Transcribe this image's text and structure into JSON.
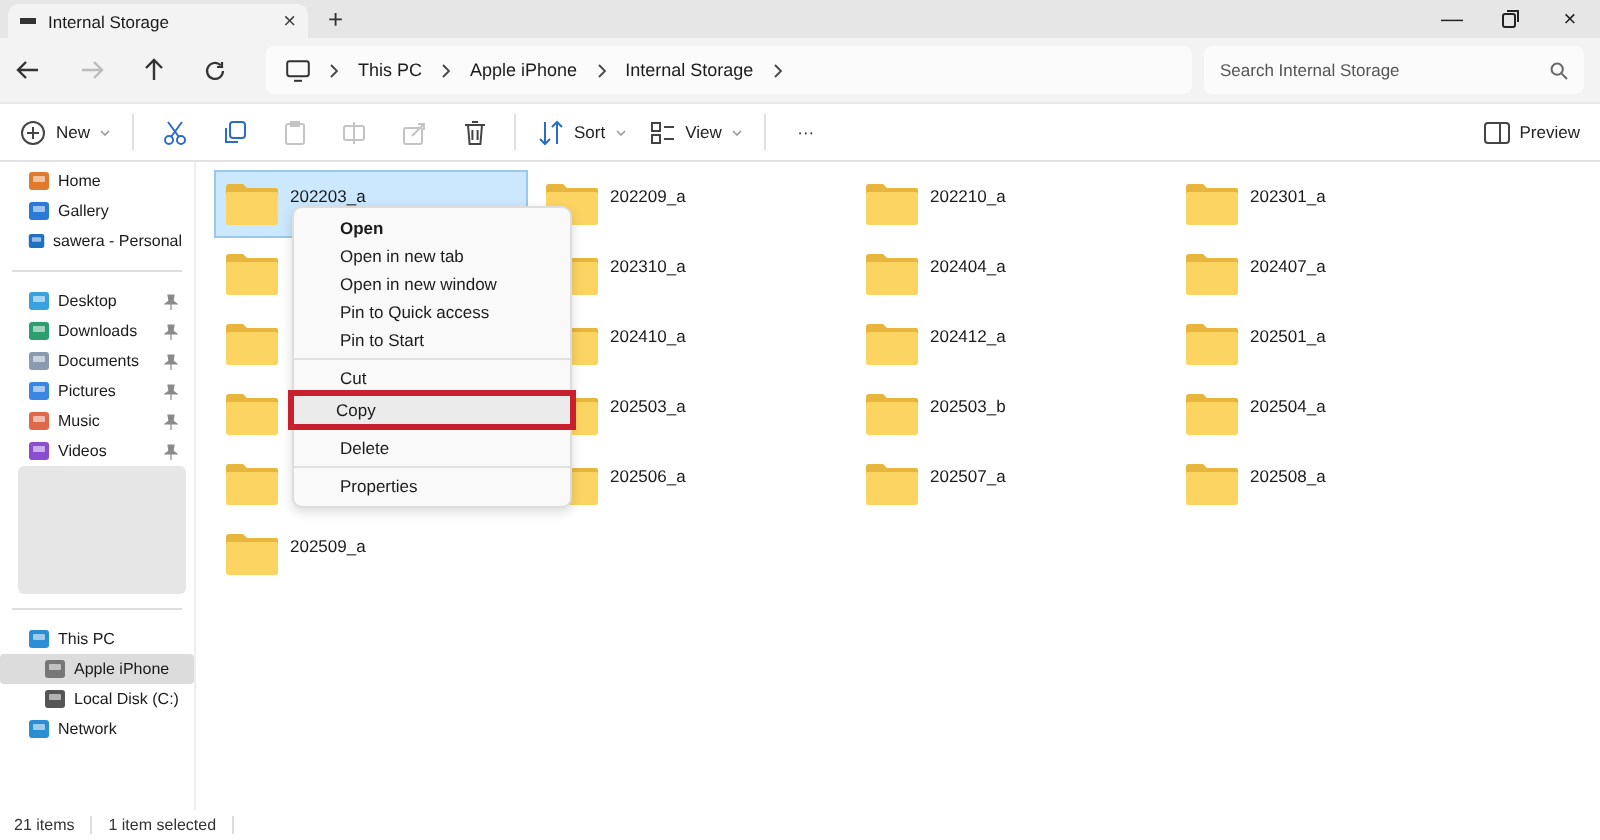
{
  "tab": {
    "title": "Internal Storage",
    "close": "×",
    "new": "+"
  },
  "window_controls": {
    "minimize": "—",
    "close": "×"
  },
  "breadcrumbs": [
    "This PC",
    "Apple iPhone",
    "Internal Storage"
  ],
  "search": {
    "placeholder": "Search Internal Storage"
  },
  "toolbar": [
    {
      "kind": "new",
      "label": "New",
      "disabled": false
    },
    {
      "kind": "cut",
      "disabled": false
    },
    {
      "kind": "copy",
      "disabled": false
    },
    {
      "kind": "paste",
      "disabled": true
    },
    {
      "kind": "rename",
      "disabled": true
    },
    {
      "kind": "share",
      "disabled": true
    },
    {
      "kind": "delete",
      "disabled": false
    },
    {
      "kind": "sort",
      "label": "Sort",
      "disabled": false
    },
    {
      "kind": "view",
      "label": "View",
      "disabled": false
    },
    {
      "kind": "more",
      "label": "···",
      "disabled": false
    }
  ],
  "preview": {
    "label": "Preview"
  },
  "sidebar": {
    "groups": [
      [
        {
          "label": "Home",
          "pinned": false,
          "selected": false
        },
        {
          "label": "Gallery",
          "pinned": false,
          "selected": false
        },
        {
          "label": "sawera - Personal",
          "pinned": false,
          "selected": false
        }
      ],
      [
        {
          "label": "Desktop",
          "pinned": true,
          "selected": false
        },
        {
          "label": "Downloads",
          "pinned": true,
          "selected": false
        },
        {
          "label": "Documents",
          "pinned": true,
          "selected": false
        },
        {
          "label": "Pictures",
          "pinned": true,
          "selected": false
        },
        {
          "label": "Music",
          "pinned": true,
          "selected": false
        },
        {
          "label": "Videos",
          "pinned": true,
          "selected": false
        }
      ],
      [
        {
          "label": "This PC",
          "pinned": false,
          "selected": false,
          "children": [
            {
              "label": "Apple iPhone",
              "pinned": false,
              "selected": true
            },
            {
              "label": "Local Disk (C:)",
              "pinned": false,
              "selected": false
            }
          ]
        },
        {
          "label": "Network",
          "pinned": false,
          "selected": false
        }
      ]
    ]
  },
  "folders": [
    {
      "name": "202203_a",
      "selected": true
    },
    {
      "name": "202209_a",
      "selected": false
    },
    {
      "name": "202210_a",
      "selected": false
    },
    {
      "name": "202301_a",
      "selected": false
    },
    {
      "selected": false
    },
    {
      "name": "202310_a",
      "selected": false
    },
    {
      "name": "202404_a",
      "selected": false
    },
    {
      "name": "202407_a",
      "selected": false
    },
    {
      "selected": false
    },
    {
      "name": "202410_a",
      "selected": false
    },
    {
      "name": "202412_a",
      "selected": false
    },
    {
      "name": "202501_a",
      "selected": false
    },
    {
      "selected": false
    },
    {
      "name": "202503_a",
      "selected": false
    },
    {
      "name": "202503_b",
      "selected": false
    },
    {
      "name": "202504_a",
      "selected": false
    },
    {
      "selected": false
    },
    {
      "name": "202506_a",
      "selected": false
    },
    {
      "name": "202507_a",
      "selected": false
    },
    {
      "name": "202508_a",
      "selected": false
    },
    {
      "name": "202509_a",
      "selected": false
    }
  ],
  "context_menu": [
    {
      "kind": "item",
      "label": "Open",
      "default": true,
      "highlighted": false
    },
    {
      "kind": "item",
      "label": "Open in new tab",
      "default": false,
      "highlighted": false
    },
    {
      "kind": "item",
      "label": "Open in new window",
      "default": false,
      "highlighted": false
    },
    {
      "kind": "item",
      "label": "Pin to Quick access",
      "default": false,
      "highlighted": false
    },
    {
      "kind": "item",
      "label": "Pin to Start",
      "default": false,
      "highlighted": false
    },
    {
      "kind": "separator"
    },
    {
      "kind": "item",
      "label": "Cut",
      "default": false,
      "highlighted": false
    },
    {
      "kind": "item",
      "label": "Copy",
      "default": false,
      "highlighted": true
    },
    {
      "kind": "separator"
    },
    {
      "kind": "item",
      "label": "Delete",
      "default": false,
      "highlighted": false
    },
    {
      "kind": "separator"
    },
    {
      "kind": "item",
      "label": "Properties",
      "default": false,
      "highlighted": false
    }
  ],
  "status_bar": [
    "21 items",
    "1 item selected"
  ]
}
